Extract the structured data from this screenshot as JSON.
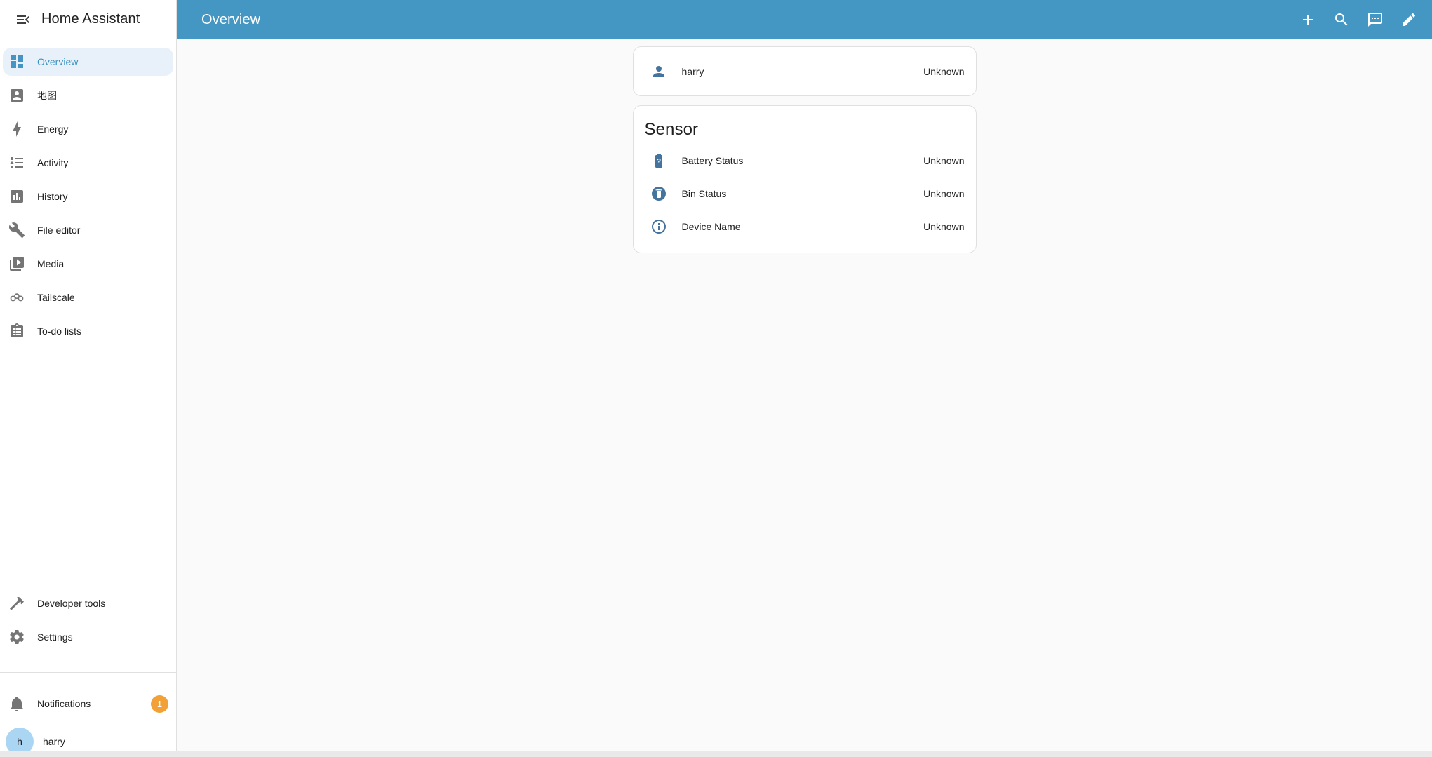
{
  "app": {
    "title": "Home Assistant"
  },
  "header": {
    "title": "Overview",
    "actions": [
      {
        "id": "add",
        "icon": "plus-icon"
      },
      {
        "id": "search",
        "icon": "magnify-icon"
      },
      {
        "id": "assist",
        "icon": "assist-chat-icon"
      },
      {
        "id": "edit-dashboard",
        "icon": "pencil-icon"
      }
    ]
  },
  "sidebar": {
    "items": [
      {
        "id": "overview",
        "label": "Overview",
        "icon": "view-dashboard-icon",
        "active": true
      },
      {
        "id": "map",
        "label": "地图",
        "icon": "account-box-icon",
        "active": false
      },
      {
        "id": "energy",
        "label": "Energy",
        "icon": "lightning-bolt-icon",
        "active": false
      },
      {
        "id": "activity",
        "label": "Activity",
        "icon": "list-type-icon",
        "active": false
      },
      {
        "id": "history",
        "label": "History",
        "icon": "chart-box-icon",
        "active": false
      },
      {
        "id": "file-editor",
        "label": "File editor",
        "icon": "wrench-icon",
        "active": false
      },
      {
        "id": "media",
        "label": "Media",
        "icon": "play-box-multiple-icon",
        "active": false
      },
      {
        "id": "tailscale",
        "label": "Tailscale",
        "icon": "tailscale-icon",
        "active": false
      },
      {
        "id": "todo-lists",
        "label": "To-do lists",
        "icon": "clipboard-list-icon",
        "active": false
      }
    ],
    "bottom_items": [
      {
        "id": "developer-tools",
        "label": "Developer tools",
        "icon": "hammer-icon"
      },
      {
        "id": "settings",
        "label": "Settings",
        "icon": "cog-icon"
      }
    ],
    "notifications": {
      "label": "Notifications",
      "badge": "1",
      "icon": "bell-icon"
    },
    "user": {
      "name": "harry",
      "avatar_initial": "h"
    }
  },
  "main": {
    "cards": [
      {
        "id": "person-card",
        "title": "",
        "rows": [
          {
            "id": "harry",
            "name": "harry",
            "state": "Unknown",
            "icon": "person-icon"
          }
        ]
      },
      {
        "id": "sensor-card",
        "title": "Sensor",
        "rows": [
          {
            "id": "battery-status",
            "name": "Battery Status",
            "state": "Unknown",
            "icon": "battery-unknown-icon"
          },
          {
            "id": "bin-status",
            "name": "Bin Status",
            "state": "Unknown",
            "icon": "delete-circle-icon"
          },
          {
            "id": "device-name",
            "name": "Device Name",
            "state": "Unknown",
            "icon": "information-outline-icon"
          }
        ]
      }
    ]
  },
  "colors": {
    "header_background": "#4597c3",
    "sidebar_active_text": "#3d93c2",
    "sidebar_active_background": "#e8f1f9",
    "entity_icon": "#44739e",
    "notification_badge": "#f1a135",
    "avatar_background": "#abd6f3"
  }
}
